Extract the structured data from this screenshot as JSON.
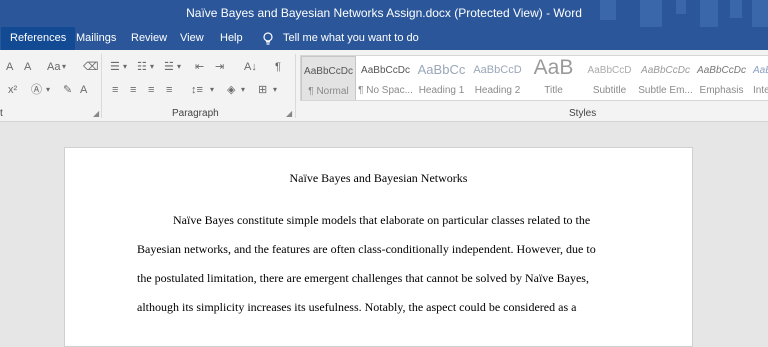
{
  "window": {
    "title": "Naïve Bayes and Bayesian Networks Assign.docx (Protected View)  -  Word"
  },
  "tabs": [
    {
      "label": "References",
      "active": true
    },
    {
      "label": "Mailings"
    },
    {
      "label": "Review"
    },
    {
      "label": "View"
    },
    {
      "label": "Help"
    }
  ],
  "tell_me": {
    "label": "Tell me what you want to do",
    "icon": "lightbulb-icon"
  },
  "ribbon": {
    "font_group": {
      "label": "t",
      "grow_font": "A",
      "shrink_font": "A",
      "change_case": "Aa",
      "superscript": "x²",
      "font_color": "A"
    },
    "paragraph_group": {
      "label": "Paragraph",
      "sort": "A↓",
      "show_marks": "¶"
    },
    "styles_group": {
      "label": "Styles",
      "items": [
        {
          "preview": "AaBbCcDc",
          "name": "¶ Normal"
        },
        {
          "preview": "AaBbCcDc",
          "name": "¶ No Spac..."
        },
        {
          "preview": "AaBbCc",
          "name": "Heading 1"
        },
        {
          "preview": "AaBbCcD",
          "name": "Heading 2"
        },
        {
          "preview": "AaB",
          "name": "Title"
        },
        {
          "preview": "AaBbCcD",
          "name": "Subtitle"
        },
        {
          "preview": "AaBbCcDc",
          "name": "Subtle Em..."
        },
        {
          "preview": "AaBbCcDc",
          "name": "Emphasis"
        },
        {
          "preview": "AaBbCcDc",
          "name": "Inte"
        }
      ]
    }
  },
  "document": {
    "title": "Naïve Bayes and Bayesian Networks",
    "lines": [
      "Naïve Bayes constitute simple models that elaborate on particular classes related to the",
      "Bayesian networks, and the features are often class-conditionally independent. However, due to",
      "the postulated limitation, there are emergent challenges that cannot be solved by Naïve Bayes,",
      "although its simplicity increases its usefulness. Notably, the aspect could be considered as a"
    ]
  },
  "colors": {
    "title_bar": "#2b579a",
    "active_tab": "#134a94",
    "ribbon": "#f3f3f3",
    "canvas": "#e6e6e6"
  }
}
